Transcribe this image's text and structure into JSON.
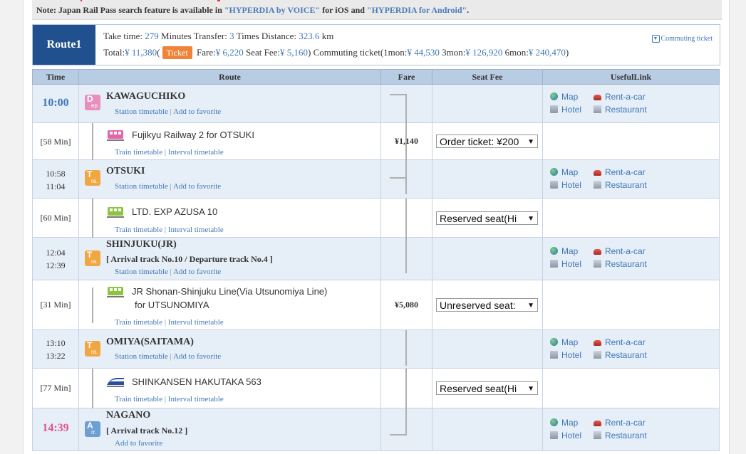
{
  "note": {
    "prefix": "Note: Japan Rail Pass search feature is available in ",
    "link1": "\"HYPERDIA by VOICE\"",
    "mid": " for iOS and ",
    "link2": "\"HYPERDIA for Android\"",
    "suffix": "."
  },
  "summary": {
    "route_label": "Route1",
    "take_time_label": "Take time: ",
    "take_time": "279",
    "minutes_label": " Minutes  Transfer: ",
    "transfer": "3",
    "times_label": " Times  Distance: ",
    "distance": "323.6",
    "km_label": " km",
    "total_label": "Total:",
    "total": "¥ 11,380",
    "paren_open": "(",
    "ticket_button": "Ticket",
    "fare_label": " Fare:",
    "fare": "¥ 6,220",
    "seat_fee_label": "  Seat Fee:",
    "seat_fee": "¥ 5,160",
    "close": ")",
    "commuting_label": "  Commuting ticket(1mon:",
    "mon1": "¥ 44,530",
    "mon3_label": "  3mon:",
    "mon3": "¥ 126,920",
    "mon6_label": "  6mon:",
    "mon6": "¥ 240,470",
    "commuting_close": ")",
    "commuting_link": "Commuting ticket"
  },
  "headers": {
    "time": "Time",
    "route": "Route",
    "fare": "Fare",
    "seat_fee": "Seat Fee",
    "useful_link": "UsefulLink"
  },
  "links": {
    "station_timetable": "Station timetable",
    "add_to_favorite": "Add to favorite",
    "train_timetable": "Train timetable",
    "interval_timetable": "Interval timetable",
    "sep": " | ",
    "map": "Map",
    "hotel": "Hotel",
    "rent_a_car": "Rent-a-car",
    "restaurant": "Restaurant"
  },
  "badges": {
    "dep": {
      "b1": "D",
      "b2": "ep."
    },
    "tra": {
      "b1": "T",
      "b2": "ra."
    },
    "arr": {
      "b1": "A",
      "b2": "rr."
    }
  },
  "stations": {
    "s1": {
      "time": "10:00",
      "name": "KAWAGUCHIKO"
    },
    "s2": {
      "time_arr": "10:58",
      "time_dep": "11:04",
      "name": "OTSUKI"
    },
    "s3": {
      "time_arr": "12:04",
      "time_dep": "12:39",
      "name": "SHINJUKU(JR)",
      "track": "[ Arrival track No.10 / Departure track No.4 ]"
    },
    "s4": {
      "time_arr": "13:10",
      "time_dep": "13:22",
      "name": "OMIYA(SAITAMA)"
    },
    "s5": {
      "time": "14:39",
      "name": "NAGANO",
      "track": "[ Arrival track No.12 ]"
    }
  },
  "trains": {
    "t1": {
      "duration": "[58 Min]",
      "name": "Fujikyu Railway 2  for OTSUKI",
      "fare": "¥1,140",
      "seat": "Order ticket: ¥200"
    },
    "t2": {
      "duration": "[60 Min]",
      "name": "LTD. EXP AZUSA 10",
      "fare": "",
      "seat": "Reserved seat(Hi"
    },
    "t3": {
      "duration": "[31 Min]",
      "name": "JR Shonan-Shinjuku Line(Via Utsunomiya Line)",
      "name2": "for UTSUNOMIYA",
      "fare": "¥5,080",
      "seat": "Unreserved seat:"
    },
    "t4": {
      "duration": "[77 Min]",
      "name": "SHINKANSEN HAKUTAKA 563",
      "fare": "",
      "seat": "Reserved seat(Hi"
    }
  },
  "colors": {
    "accent": "#3f78b5",
    "route_badge": "#21508f",
    "ticket_button": "#f08337",
    "arrival_time": "#e0568e"
  }
}
